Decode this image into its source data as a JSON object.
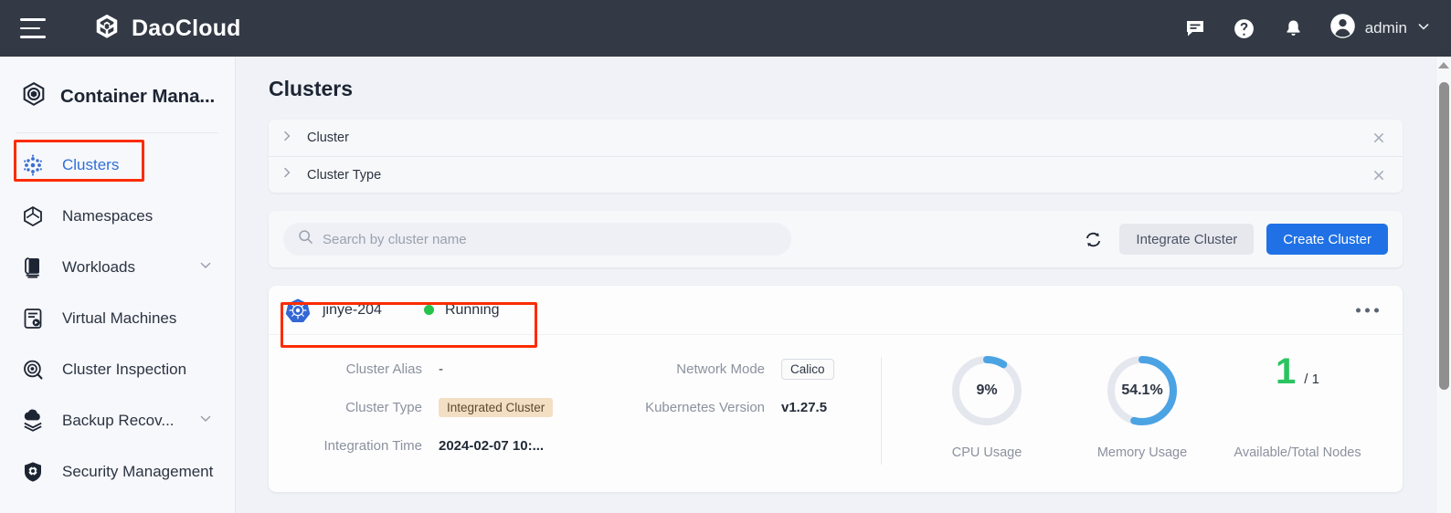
{
  "topbar": {
    "menu_icon": "hamburger-icon",
    "brand": "DaoCloud",
    "brand_icon": "daocloud-cube-logo",
    "icons": [
      "feedback-message-icon",
      "help-question-icon",
      "notification-bell-icon"
    ],
    "user": "admin",
    "user_avatar_icon": "user-avatar-icon",
    "user_caret_icon": "chevron-down-icon"
  },
  "sidebar": {
    "product": "Container Mana...",
    "product_icon": "container-management-icon",
    "items": [
      {
        "label": "Clusters",
        "icon": "clusters-icon",
        "active": true,
        "expandable": false
      },
      {
        "label": "Namespaces",
        "icon": "namespaces-icon",
        "active": false,
        "expandable": false
      },
      {
        "label": "Workloads",
        "icon": "workloads-icon",
        "active": false,
        "expandable": true
      },
      {
        "label": "Virtual Machines",
        "icon": "virtual-machines-icon",
        "active": false,
        "expandable": false
      },
      {
        "label": "Cluster Inspection",
        "icon": "cluster-inspection-icon",
        "active": false,
        "expandable": false
      },
      {
        "label": "Backup Recov...",
        "icon": "backup-recovery-icon",
        "active": false,
        "expandable": true
      },
      {
        "label": "Security Management",
        "icon": "security-management-icon",
        "active": false,
        "expandable": false
      }
    ]
  },
  "main": {
    "page_title": "Clusters",
    "filters": [
      {
        "label": "Cluster",
        "expand_icon": "chevron-right-icon",
        "close_icon": "close-x-icon"
      },
      {
        "label": "Cluster Type",
        "expand_icon": "chevron-right-icon",
        "close_icon": "close-x-icon"
      }
    ],
    "search": {
      "placeholder": "Search by cluster name",
      "value": "",
      "icon": "search-icon"
    },
    "toolbar": {
      "refresh_icon": "refresh-icon",
      "integrate_label": "Integrate Cluster",
      "create_label": "Create Cluster",
      "primary_color": "#2071e5"
    },
    "cluster": {
      "name": "jinye-204",
      "name_icon": "kubernetes-icon",
      "status": "Running",
      "status_color": "#27c24c",
      "more_icon": "more-options-icon",
      "fields": [
        {
          "label": "Cluster Alias",
          "value": "-",
          "style": "plain"
        },
        {
          "label": "Network Mode",
          "value": "Calico",
          "style": "tag-outline"
        },
        {
          "label": "Cluster Type",
          "value": "Integrated Cluster",
          "style": "tag-orange"
        },
        {
          "label": "Kubernetes Version",
          "value": "v1.27.5",
          "style": "bold"
        },
        {
          "label": "Integration Time",
          "value": "2024-02-07 10:...",
          "style": "bold"
        }
      ],
      "metrics": [
        {
          "label": "CPU Usage",
          "display": "9%",
          "percent": 9,
          "color": "#4ba3e3"
        },
        {
          "label": "Memory Usage",
          "display": "54.1%",
          "percent": 54.1,
          "color": "#4ba3e3"
        }
      ],
      "nodes": {
        "available": "1",
        "total": "/ 1",
        "label": "Available/Total Nodes",
        "color": "#2ac45f"
      }
    }
  },
  "scrollbar": {
    "up_arrow_icon": "scroll-up-arrow-icon",
    "thumb": "scroll-thumb"
  },
  "highlights": [
    {
      "name": "highlight-clusters-nav",
      "color": "#fb2c00"
    },
    {
      "name": "highlight-cluster-row",
      "color": "#fb2c00"
    }
  ]
}
